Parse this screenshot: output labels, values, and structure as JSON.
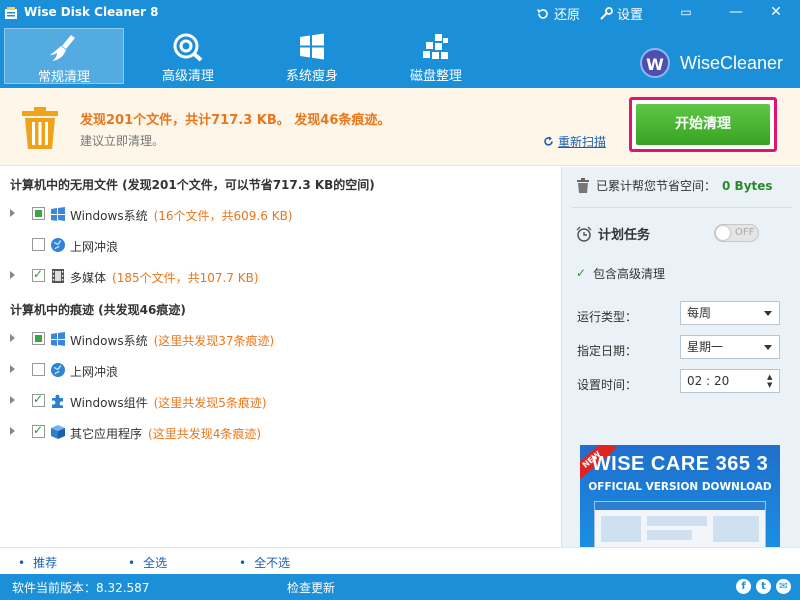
{
  "window": {
    "title": "Wise Disk Cleaner 8",
    "restore_label": "还原",
    "settings_label": "设置",
    "minimize": "▭",
    "maximize": "—",
    "close": "✕"
  },
  "nav": {
    "items": [
      {
        "label": "常规清理",
        "icon": "broom-icon",
        "active": true
      },
      {
        "label": "高级清理",
        "icon": "disk-scan-icon",
        "active": false
      },
      {
        "label": "系统瘦身",
        "icon": "windows-logo-icon",
        "active": false
      },
      {
        "label": "磁盘整理",
        "icon": "defrag-blocks-icon",
        "active": false
      }
    ]
  },
  "brand": {
    "logo_letter": "W",
    "name": "WiseCleaner"
  },
  "result": {
    "summary": "发现201个文件，共计717.3 KB。 发现46条痕迹。",
    "suggestion": "建议立即清理。",
    "rescan_label": "重新扫描",
    "start_label": "开始清理"
  },
  "junk_section": {
    "title": "计算机中的无用文件 (发现201个文件，可以节省717.3 KB的空间)",
    "rows": [
      {
        "label": "Windows系统",
        "note": "(16个文件，共609.6 KB)",
        "state": "partial",
        "icon": "windows-flag-icon",
        "expandable": true
      },
      {
        "label": "上网冲浪",
        "note": "",
        "state": "unchecked",
        "icon": "globe-icon",
        "expandable": false
      },
      {
        "label": "多媒体",
        "note": "(185个文件，共107.7 KB)",
        "state": "checked",
        "icon": "film-icon",
        "expandable": true
      }
    ]
  },
  "trace_section": {
    "title": "计算机中的痕迹 (共发现46痕迹)",
    "rows": [
      {
        "label": "Windows系统",
        "note": "(这里共发现37条痕迹)",
        "state": "partial",
        "icon": "windows-flag-icon",
        "expandable": true
      },
      {
        "label": "上网冲浪",
        "note": "",
        "state": "unchecked",
        "icon": "globe-icon",
        "expandable": true
      },
      {
        "label": "Windows组件",
        "note": "(这里共发现5条痕迹)",
        "state": "checked",
        "icon": "puzzle-icon",
        "expandable": true
      },
      {
        "label": "其它应用程序",
        "note": "(这里共发现4条痕迹)",
        "state": "checked",
        "icon": "box-icon",
        "expandable": true
      }
    ]
  },
  "side": {
    "saved_label": "已累计帮您节省空间：",
    "saved_value": "0 Bytes",
    "schedule_label": "计划任务",
    "toggle_text": "OFF",
    "include_advanced": "包含高级清理",
    "run_type_label": "运行类型：",
    "run_type_value": "每周",
    "date_label": "指定日期：",
    "date_value": "星期一",
    "time_label": "设置时间：",
    "time_value": "02 : 20",
    "ad_badge": "NEW",
    "ad_title": "WISE CARE 365 3",
    "ad_subtitle": "OFFICIAL VERSION DOWNLOAD"
  },
  "bottom_links": {
    "recommend": "推荐",
    "select_all": "全选",
    "select_none": "全不选"
  },
  "status": {
    "version": "软件当前版本：8.32.587",
    "check_update": "检查更新",
    "social": [
      "f",
      "t",
      "✉"
    ]
  },
  "colors": {
    "header": "#1b8fd8",
    "accent_orange": "#e8771c",
    "start_green": "#3ea827",
    "highlight_frame": "#e0166e"
  }
}
